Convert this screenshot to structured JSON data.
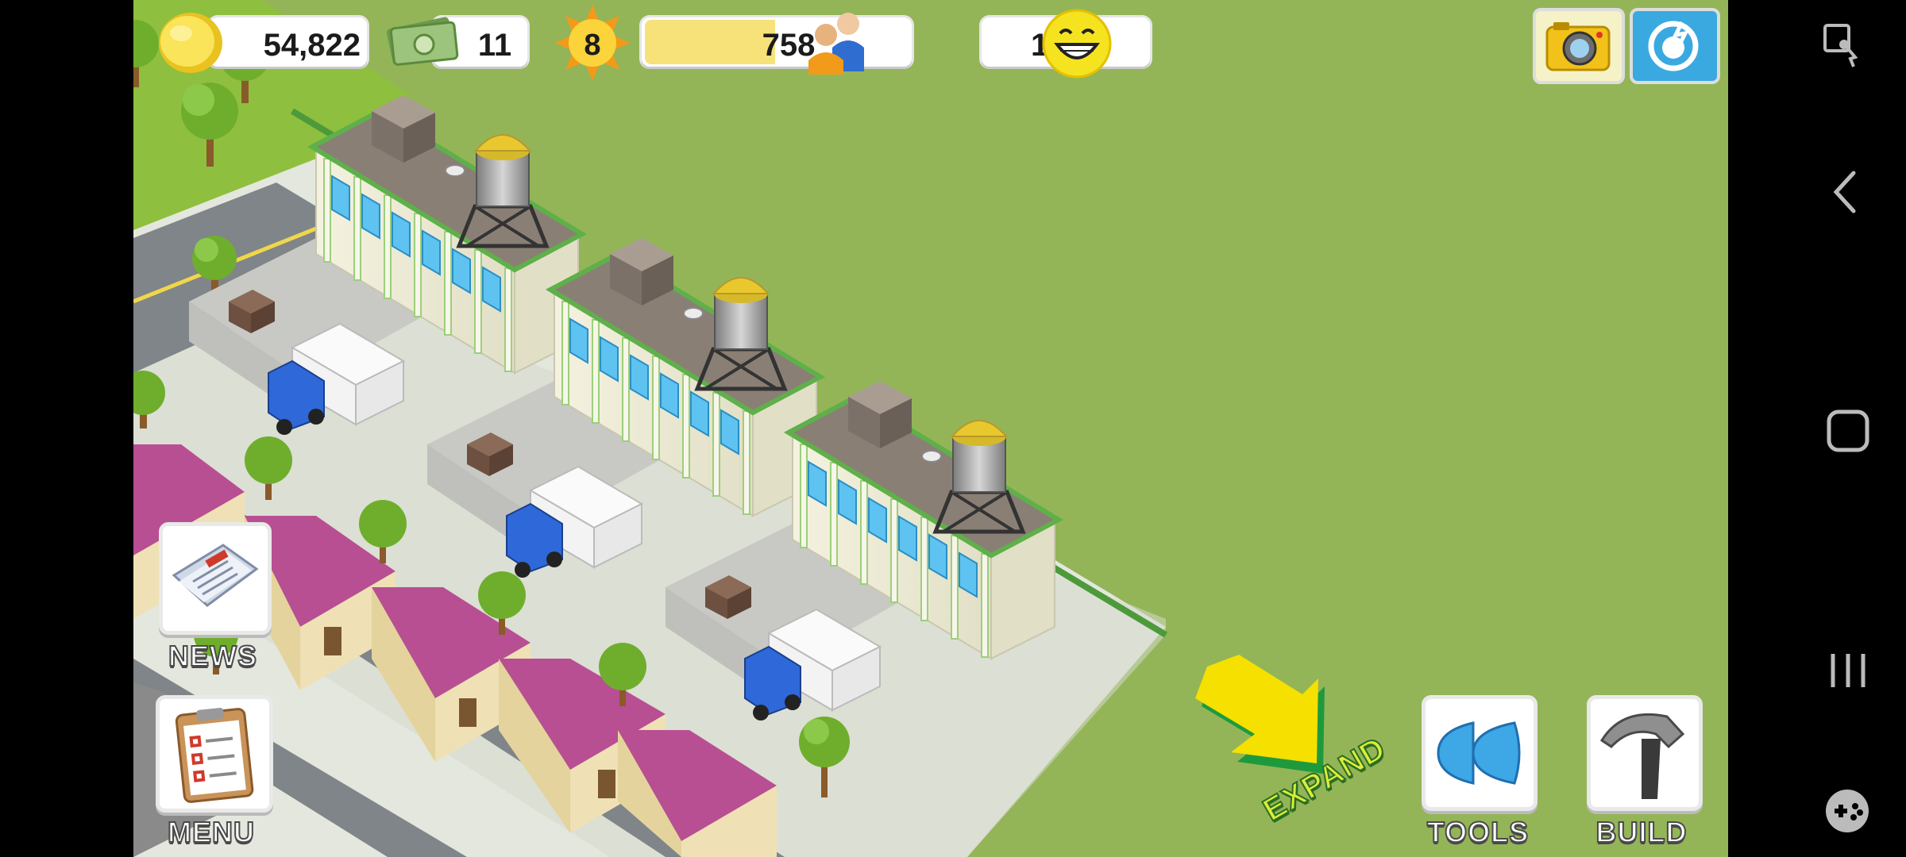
{
  "hud": {
    "coins": "54,822",
    "cash": "11",
    "level": "8",
    "xp": "758",
    "population": "1,360"
  },
  "buttons": {
    "news": "NEWS",
    "menu": "MENU",
    "tools": "TOOLS",
    "build": "BUILD",
    "expand": "EXPAND"
  },
  "icons": {
    "coin": "gold-coin-icon",
    "cash": "dollar-bills-icon",
    "level": "sun-star-icon",
    "population": "people-icon",
    "happiness": "smiley-face-icon",
    "camera": "camera-icon",
    "social": "social-share-icon"
  },
  "colors": {
    "grass": "#93b558",
    "accent_yellow": "#f5e000",
    "roof_purple": "#b84f92",
    "xp_bar": "#f7e27a"
  }
}
